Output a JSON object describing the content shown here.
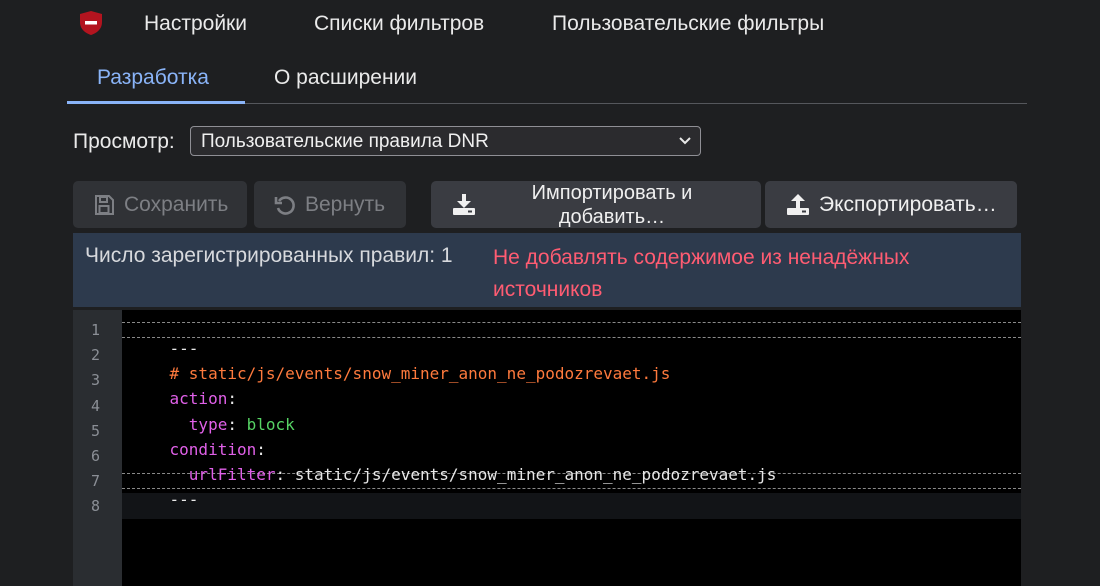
{
  "topnav": {
    "items": [
      {
        "label": "Настройки"
      },
      {
        "label": "Списки фильтров"
      },
      {
        "label": "Пользовательские фильтры"
      }
    ]
  },
  "subnav": {
    "items": [
      {
        "label": "Разработка",
        "active": true
      },
      {
        "label": "О расширении"
      }
    ]
  },
  "view": {
    "label": "Просмотр:",
    "selected": "Пользовательские правила DNR"
  },
  "toolbar": {
    "save_label": "Сохранить",
    "revert_label": "Вернуть",
    "import_label_line1": "Импортировать и",
    "import_label_line2": "добавить…",
    "export_label": "Экспортировать…"
  },
  "info": {
    "count_text": "Число зарегистрированных правил: 1",
    "warning": "Не добавлять содержимое из ненадёжных источников"
  },
  "editor": {
    "line_numbers": [
      "1",
      "2",
      "3",
      "4",
      "5",
      "6",
      "7",
      "8"
    ],
    "lines": {
      "l1": "---",
      "l2": "# static/js/events/snow_miner_anon_ne_podozrevaet.js",
      "l3_key": "action",
      "l4_key": "type",
      "l4_val": "block",
      "l5_key": "condition",
      "l6_key": "urlFilter",
      "l6_val": "static/js/events/snow_miner_anon_ne_podozrevaet.js",
      "l7": "---"
    }
  },
  "colors": {
    "accent": "#8ab4f8",
    "warning": "#ff5c72",
    "info_bg": "#2d3a4d",
    "yaml_comment": "#ff7a3d",
    "yaml_key": "#e060e8",
    "yaml_value": "#56d364"
  },
  "icons": [
    "shield-logo-icon",
    "save-icon",
    "revert-icon",
    "import-icon",
    "export-icon",
    "chevron-down-icon"
  ]
}
